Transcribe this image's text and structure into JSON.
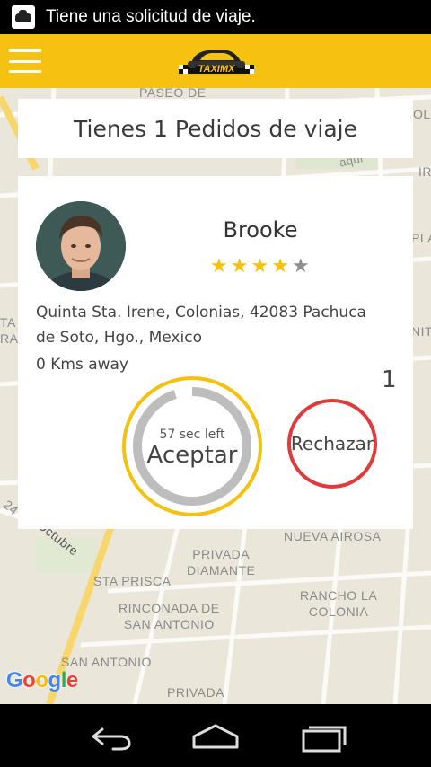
{
  "status_bar": {
    "notification_text": "Tiene una solicitud de viaje."
  },
  "app_bar": {
    "logo_text": "TAXIMX"
  },
  "map": {
    "labels": {
      "paseo": "PASEO DE",
      "octubre": "Octubre",
      "privada_diamante": "PRIVADA\nDIAMANTE",
      "nueva_airosa": "NUEVA AIROSA",
      "sta_prisca": "STA PRISCA",
      "rinconada": "RINCONADA DE\nSAN ANTONIO",
      "rancho": "RANCHO LA\nCOLONIA",
      "san_antonio": "SAN ANTONIO",
      "privada": "PRIVADA",
      "num_24": "24",
      "ta": "TA",
      "ra": "RA",
      "pla": "PLA",
      "olf": "OLF",
      "ir": "IR",
      "nit": "NIT",
      "aqui": "aqui"
    },
    "attribution": "Google"
  },
  "request_header": {
    "title": "Tienes 1 Pedidos de viaje"
  },
  "request": {
    "rider_name": "Brooke",
    "rating": 4,
    "rating_max": 5,
    "address": "Quinta Sta. Irene, Colonias, 42083 Pachuca de Soto, Hgo., Mexico",
    "distance": "0 Kms away",
    "count": "1",
    "timer_text": "57 sec left",
    "timer_progress": 0.95,
    "accept_label": "Aceptar",
    "reject_label": "Rechazar"
  },
  "colors": {
    "accent": "#f6c211",
    "reject": "#e03b3b",
    "ring": "#bdbdbd"
  },
  "nav_bar": {
    "back_icon": "back-icon",
    "home_icon": "home-icon",
    "recents_icon": "recents-icon"
  }
}
